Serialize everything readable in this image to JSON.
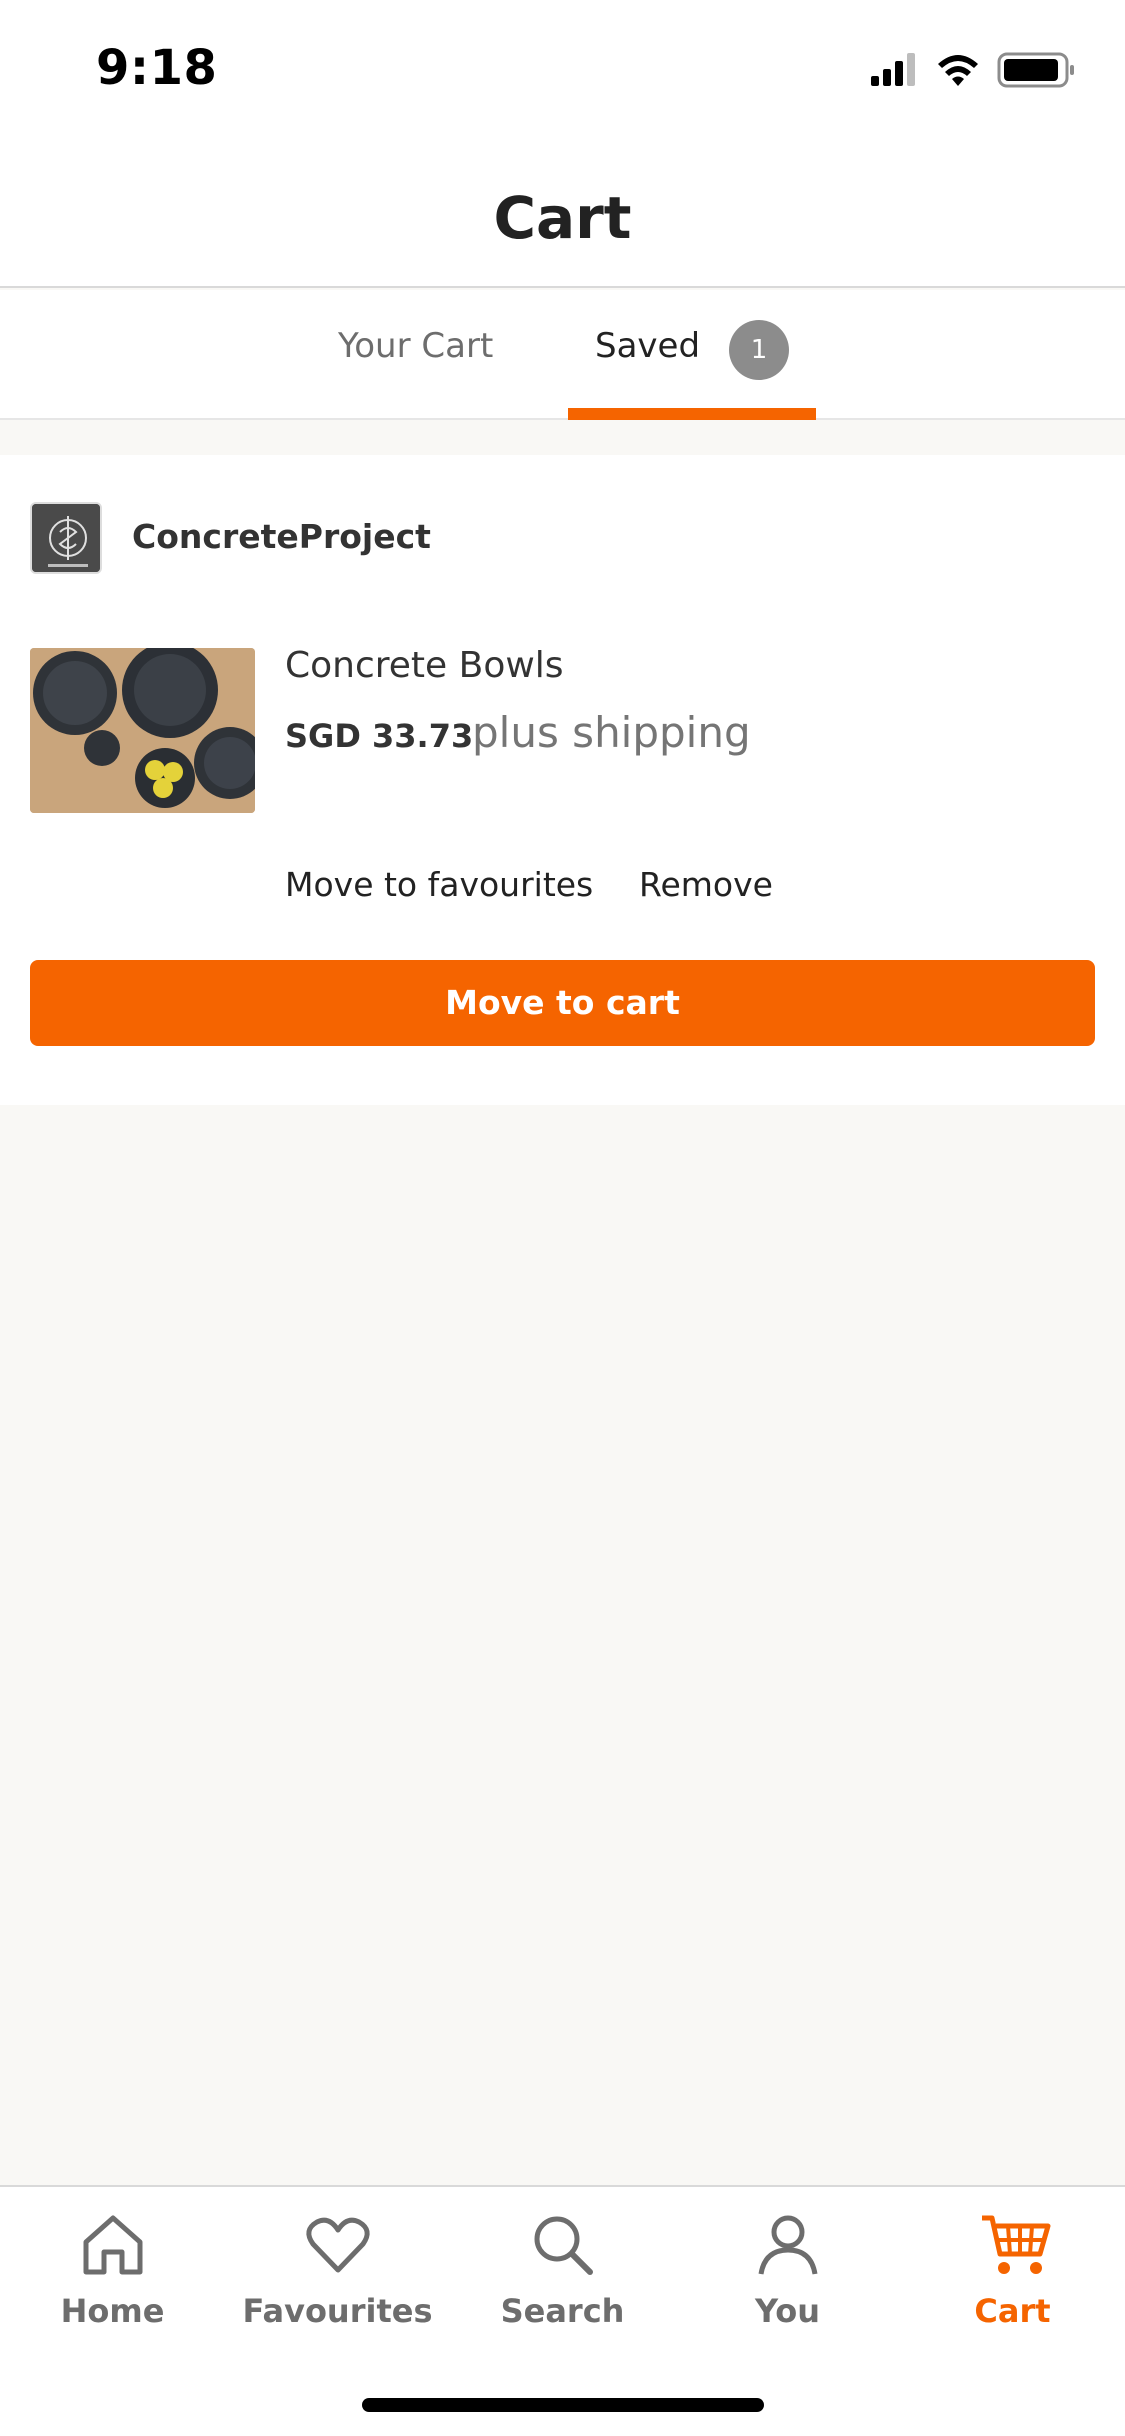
{
  "status": {
    "time": "9:18"
  },
  "header": {
    "title": "Cart"
  },
  "tabs": {
    "cart_label": "Your Cart",
    "saved_label": "Saved",
    "saved_count": "1"
  },
  "saved_item": {
    "shop_name": "ConcreteProject",
    "title": "Concrete Bowls",
    "price": "SGD 33.73",
    "shipping": "plus shipping",
    "move_to_favourites": "Move to favourites",
    "remove": "Remove",
    "move_to_cart": "Move to cart"
  },
  "bottom_nav": {
    "items": [
      {
        "label": "Home",
        "icon": "home-icon"
      },
      {
        "label": "Favourites",
        "icon": "heart-icon"
      },
      {
        "label": "Search",
        "icon": "search-icon"
      },
      {
        "label": "You",
        "icon": "person-icon"
      },
      {
        "label": "Cart",
        "icon": "cart-icon"
      }
    ],
    "active_index": 4
  },
  "colors": {
    "accent": "#f56400",
    "muted": "#6d6d6d",
    "background": "#f9f8f5"
  }
}
